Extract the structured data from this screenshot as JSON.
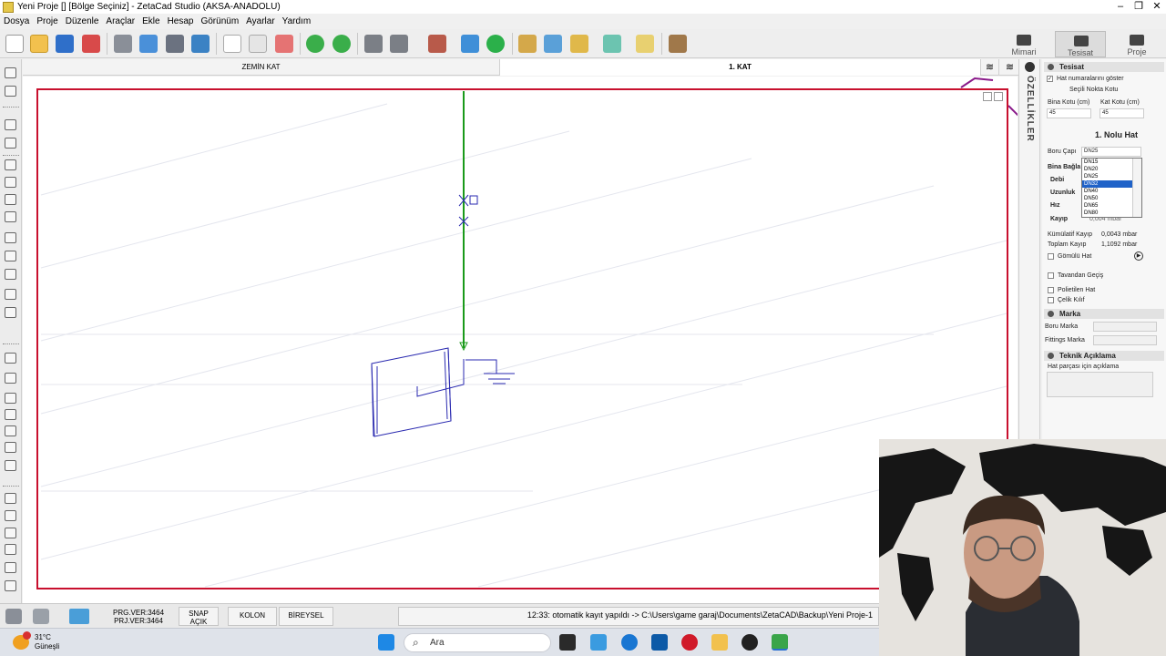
{
  "window": {
    "title": "Yeni Proje  []  [Bölge Seçiniz] - ZetaCad Studio (AKSA-ANADOLU)"
  },
  "menu": [
    "Dosya",
    "Proje",
    "Düzenle",
    "Araçlar",
    "Ekle",
    "Hesap",
    "Görünüm",
    "Ayarlar",
    "Yardım"
  ],
  "right_tabs": {
    "mimari": "Mimari",
    "tesisat": "Tesisat",
    "proje": "Proje"
  },
  "floor_tabs": {
    "zemin": "ZEMİN KAT",
    "kat1": "1. KAT"
  },
  "side_strip": {
    "label": "ÖZELLİKLER"
  },
  "panel": {
    "tesisat_header": "Tesisat",
    "hat_numara_label": "Hat numaralarını göster",
    "secili_nokta": "Seçili Nokta Kotu",
    "bina_kotu_label": "Bina Kotu (cm)",
    "kat_kotu_label": "Kat Kotu (cm)",
    "bina_kotu_value": "45",
    "kat_kotu_value": "45",
    "hat_title": "1. Nolu Hat",
    "boru_capi_label": "Boru Çapı",
    "boru_capi_value": "DN25",
    "bina_baglanti_label": "Bina Bağla",
    "debi_label": "Debi",
    "uzunluk_label": "Uzunluk",
    "hiz_label": "Hız",
    "kayip_label": "Kayıp",
    "kayip_value": "0,004 mbar",
    "kumulatif_label": "Kümülatif Kayıp",
    "kumulatif_value": "0,0043 mbar",
    "toplam_label": "Toplam Kayıp",
    "toplam_value": "1,1092 mbar",
    "gomulu_label": "Gömülü Hat",
    "tavandan_label": "Tavandan Geçiş",
    "polietilen_label": "Polietilen Hat",
    "celik_label": "Çelik Kılıf",
    "marka_header": "Marka",
    "boru_marka_label": "Boru Marka",
    "fittings_marka_label": "Fittings Marka",
    "teknik_header": "Teknik Açıklama",
    "hat_parcasi_label": "Hat parçası için açıklama"
  },
  "dropdown_options": [
    "DN15",
    "DN20",
    "DN25",
    "DN32",
    "DN40",
    "DN50",
    "DN65",
    "DN80"
  ],
  "dropdown_selected": "DN32",
  "status": {
    "prg_ver": "PRG.VER:3464",
    "prj_ver": "PRJ.VER:3464",
    "snap_label": "SNAP",
    "snap_value": "AÇIK",
    "kolon": "KOLON",
    "bireysel": "BİREYSEL",
    "message": "12:33: otomatik kayıt yapıldı -> C:\\Users\\game garaj\\Documents\\ZetaCAD\\Backup\\Yeni Proje-1"
  },
  "taskbar": {
    "weather_temp": "31°C",
    "weather_text": "Güneşli",
    "search_placeholder": "Ara"
  },
  "colors": {
    "frame": "#c8102e",
    "pipe": "#1a9a1a",
    "drawing": "#2a2ab0",
    "selection": "#1f62c8"
  }
}
